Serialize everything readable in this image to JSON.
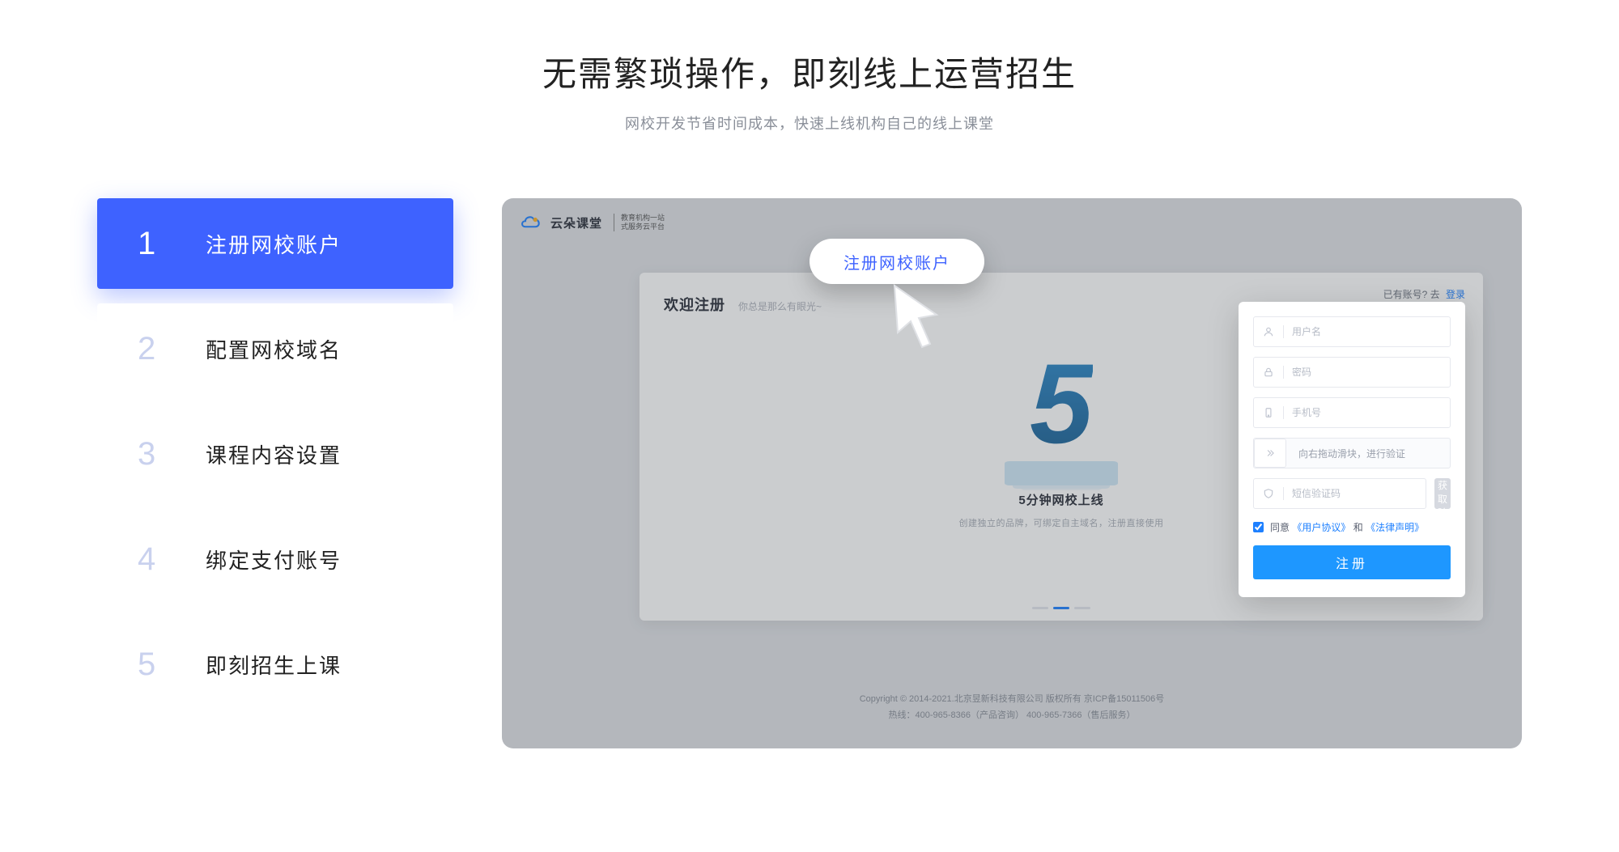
{
  "hero": {
    "title": "无需繁琐操作，即刻线上运营招生",
    "subtitle": "网校开发节省时间成本，快速上线机构自己的线上课堂"
  },
  "steps": [
    {
      "num": "1",
      "label": "注册网校账户",
      "active": true
    },
    {
      "num": "2",
      "label": "配置网校域名",
      "active": false
    },
    {
      "num": "3",
      "label": "课程内容设置",
      "active": false
    },
    {
      "num": "4",
      "label": "绑定支付账号",
      "active": false
    },
    {
      "num": "5",
      "label": "即刻招生上课",
      "active": false
    }
  ],
  "preview": {
    "brand_name": "云朵课堂",
    "brand_sub_line1": "教育机构一站",
    "brand_sub_line2": "式服务云平台",
    "tip_pill": "注册网校账户",
    "welcome": "欢迎注册",
    "slogan": "你总是那么有眼光~",
    "have_account_text": "已有账号? 去",
    "login_link": "登录",
    "five_big": "5",
    "five_title": "5分钟网校上线",
    "five_sub": "创建独立的品牌，可绑定自主域名，注册直接使用",
    "form": {
      "username_ph": "用户名",
      "password_ph": "密码",
      "phone_ph": "手机号",
      "slider_text": "向右拖动滑块，进行验证",
      "code_ph": "短信验证码",
      "code_btn": "获取验证码",
      "agree_prefix": "同意",
      "agree_user": "《用户协议》",
      "agree_and": "和",
      "agree_law": "《法律声明》",
      "submit": "注册"
    },
    "footer_line1": "Copyright © 2014-2021.北京昱新科技有限公司 版权所有   京ICP备15011506号",
    "footer_line2": "热线：400-965-8366（产品咨询） 400-965-7366（售后服务）"
  }
}
